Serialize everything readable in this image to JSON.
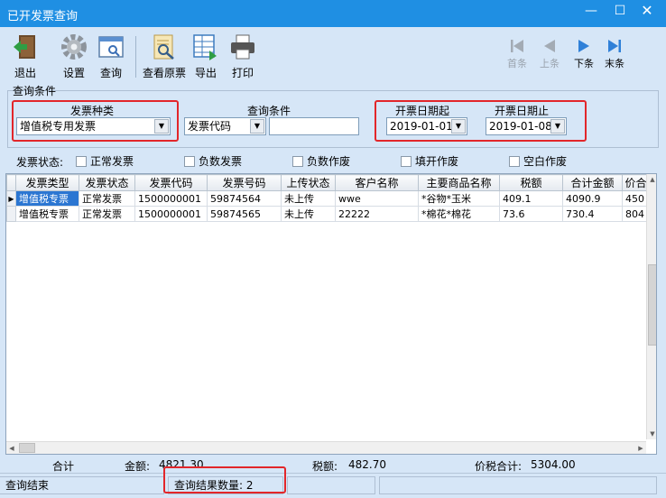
{
  "window": {
    "title": "已开发票查询",
    "controls": {
      "minimize": "—",
      "maximize": "☐",
      "close": "✕"
    }
  },
  "toolbar": {
    "exit": "退出",
    "settings": "设置",
    "query": "查询",
    "view_original": "查看原票",
    "export": "导出",
    "print": "打印",
    "first": "首条",
    "prev": "上条",
    "next": "下条",
    "last": "末条"
  },
  "conditions": {
    "group_title": "查询条件",
    "invoice_type_label": "发票种类",
    "invoice_type_value": "增值税专用发票",
    "query_cond_label": "查询条件",
    "query_cond_value": "发票代码",
    "query_cond_text": "",
    "date_from_label": "开票日期起",
    "date_from_value": "2019-01-01",
    "date_to_label": "开票日期止",
    "date_to_value": "2019-01-08"
  },
  "status_filter": {
    "label": "发票状态:",
    "options": [
      "正常发票",
      "负数发票",
      "负数作废",
      "填开作废",
      "空白作废"
    ]
  },
  "grid": {
    "columns": [
      "发票类型",
      "发票状态",
      "发票代码",
      "发票号码",
      "上传状态",
      "客户名称",
      "主要商品名称",
      "税额",
      "合计金额",
      "价合"
    ],
    "rows": [
      [
        "增值税专票",
        "正常发票",
        "1500000001",
        "59874564",
        "未上传",
        "wwe",
        "*谷物*玉米",
        "409.1",
        "4090.9",
        "450"
      ],
      [
        "增值税专票",
        "正常发票",
        "1500000001",
        "59874565",
        "未上传",
        "22222",
        "*棉花*棉花",
        "73.6",
        "730.4",
        "804"
      ]
    ]
  },
  "totals": {
    "label": "合计",
    "amount_label": "金额:",
    "amount_value": "4821.30",
    "tax_label": "税额:",
    "tax_value": "482.70",
    "total_label": "价税合计:",
    "total_value": "5304.00"
  },
  "statusbar": {
    "message": "查询结束",
    "count_label": "查询结果数量:",
    "count_value": "2"
  },
  "colors": {
    "titlebar": "#1f8fe3",
    "highlight": "#e2262a",
    "selection": "#2b76d2",
    "nav_active": "#2f80d8"
  }
}
